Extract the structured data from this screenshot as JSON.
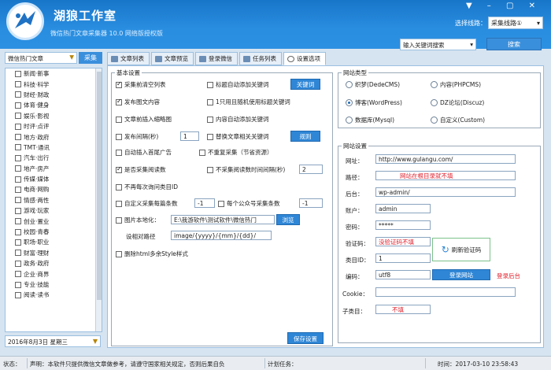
{
  "header": {
    "app_title": "湖狼工作室",
    "subtitle": "微信热门文章采集器 10.0 网络版授权版",
    "line_label": "选择线路：",
    "line_value": "采集线路①",
    "keyword_placeholder": "输入关键词搜索",
    "search_label": "搜索",
    "window_controls": "▼ – ▢ ✕"
  },
  "sidebar": {
    "category_select": "微信热门文章",
    "collect_label": "采集",
    "categories": [
      "新闻·新事",
      "科技·科学",
      "财经·财政",
      "体育·健身",
      "娱乐·影视",
      "时评·点评",
      "地方·政府",
      "TMT·通讯",
      "汽车·出行",
      "地产·房产",
      "传媒·媒体",
      "电商·网购",
      "情感·两性",
      "游戏·玩家",
      "创业·置业",
      "校园·青春",
      "职场·职业",
      "财富·理财",
      "政务·政府",
      "企业·商界",
      "专业·技能",
      "阅读·读书"
    ],
    "date": "2016年8月3日  星期三"
  },
  "tabs": [
    {
      "label": "文章列表",
      "active": false
    },
    {
      "label": "文章预览",
      "active": false
    },
    {
      "label": "登录微信",
      "active": false
    },
    {
      "label": "任务列表",
      "active": false
    },
    {
      "label": "设置选项",
      "active": true
    }
  ],
  "basic": {
    "legend": "基本设置",
    "opt_collect_before": "采集前清空列表",
    "opt_title_keyword": "标题自动添加关键词",
    "keyword_btn": "关键词",
    "opt_publish_images": "发布图文内容",
    "opt_random_keyword": "1只用且随机使用标题关键词",
    "opt_insert_thumb": "文章前插入缩略图",
    "opt_content_keyword": "内容自动添加关键词",
    "opt_publish_interval": "发布间隔(秒)",
    "publish_interval_value": "1",
    "opt_replace_keyword": "替换文章相关关键词",
    "rules_btn": "规则",
    "opt_auto_ad": "自动插入首尾广告",
    "opt_no_repeat": "不重复采集（节省资源）",
    "opt_collect_reads": "是否采集阅读数",
    "opt_no_reads_interval": "不采集阅读数时间间隔(秒)",
    "no_reads_interval_value": "2",
    "opt_no_query_cat": "不再每次询问类目ID",
    "opt_custom_count": "自定义采集每篇条数",
    "custom_count_value": "-1",
    "per_account_label": "每个公众号采集条数",
    "per_account_value": "-1",
    "opt_image_local": "图片本地化：",
    "image_path": "E:\\我游软件\\测试软件\\微信热门",
    "browse_btn": "浏览",
    "image_rule_label": "设相对路径",
    "image_rule_value": "image/{yyyy}/{mm}/{dd}/",
    "opt_remove_style": "删除html多余Style样式",
    "save_btn": "保存设置"
  },
  "site_type": {
    "legend": "网站类型",
    "options": [
      {
        "label": "织梦(DedeCMS)",
        "checked": false
      },
      {
        "label": "内容(PHPCMS)",
        "checked": false
      },
      {
        "label": "博客(WordPress)",
        "checked": true
      },
      {
        "label": "DZ论坛(Discuz)",
        "checked": false
      },
      {
        "label": "数据库(Mysql)",
        "checked": false
      },
      {
        "label": "自定义(Custom)",
        "checked": false
      }
    ]
  },
  "site": {
    "legend": "网站设置",
    "url_label": "网址：",
    "url_value": "http://www.gulangu.com/",
    "path_label": "路径：",
    "path_value": "网站在根目录就不填",
    "admin_label": "后台：",
    "admin_value": "wp-admin/",
    "account_label": "账户：",
    "account_value": "admin",
    "password_label": "密码：",
    "password_value": "*****",
    "captcha_label": "验证码：",
    "captcha_value": "没验证码不填",
    "refresh_captcha": "刷新验证码",
    "catid_label": "类目ID：",
    "catid_value": "1",
    "encoding_label": "编码：",
    "encoding_value": "utf8",
    "login_btn": "登录网站",
    "login_hint": "登录后台",
    "cookie_label": "Cookie：",
    "subcat_label": "子类目：",
    "subcat_value": "不填"
  },
  "status": {
    "state": "状态：",
    "notice": "声明：本软件只提供微信文章做参考，请遵守国家相关规定，否则后果自负",
    "plan_label": "计划任务：",
    "time": "时间：2017-03-10 23:58:43"
  },
  "colors": {
    "header": "#2a8ee0",
    "accent": "#2f86d6",
    "hint_red": "#e0222e"
  }
}
